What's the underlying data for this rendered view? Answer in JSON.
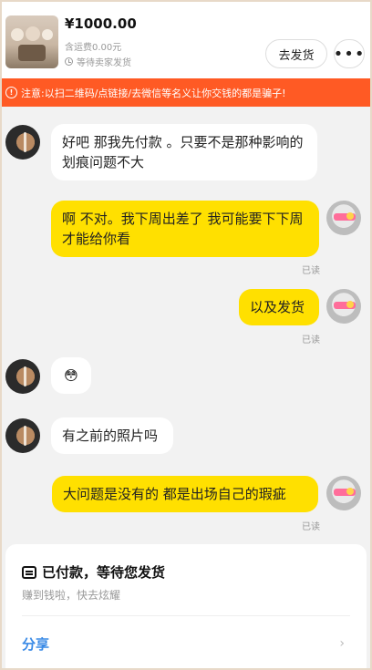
{
  "header": {
    "price": "¥1000.00",
    "shipping": "含运费0.00元",
    "status": "等待卖家发货",
    "ship_button": "去发货",
    "more_button": "•••"
  },
  "warning": {
    "icon_text": "!",
    "text": "注意:以扫二维码/点链接/去微信等名义让你交钱的都是骗子!"
  },
  "messages": [
    {
      "side": "in",
      "text": "好吧 那我先付款 。只要不是那种影响的划痕问题不大"
    },
    {
      "side": "out",
      "text": "啊 不对。我下周出差了 我可能要下下周才能给你看",
      "read": "已读"
    },
    {
      "side": "out",
      "text": "以及发货",
      "read": "已读"
    },
    {
      "side": "in",
      "text": "😳"
    },
    {
      "side": "in",
      "text": "有之前的照片吗"
    },
    {
      "side": "out",
      "text": "大问题是没有的 都是出场自己的瑕疵",
      "read": "已读"
    }
  ],
  "card": {
    "title": "已付款，等待您发货",
    "subtitle": "赚到钱啦，快去炫耀",
    "share": "分享",
    "chevron": "›"
  },
  "colors": {
    "warning_bg": "#ff5a24",
    "outgoing_bubble": "#ffe000",
    "share_link": "#3a8ae6"
  }
}
